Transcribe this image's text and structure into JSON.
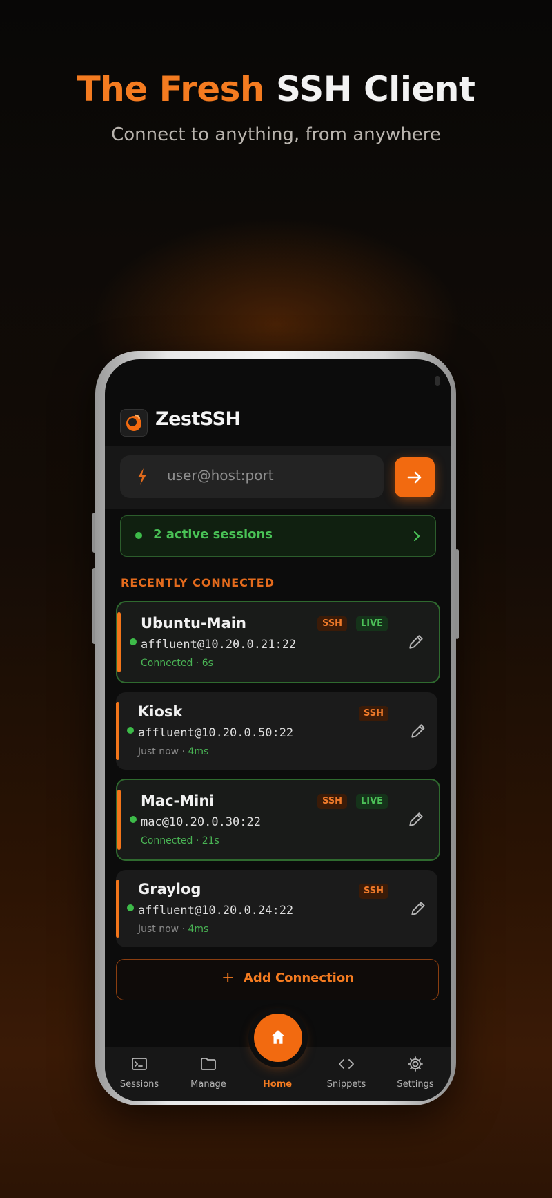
{
  "hero": {
    "title_accent": "The Fresh",
    "title_rest": "SSH Client",
    "subtitle": "Connect to anything, from anywhere"
  },
  "app": {
    "name": "ZestSSH",
    "logo_icon": "zest-logo-icon"
  },
  "quick_connect": {
    "placeholder": "user@host:port",
    "bolt_icon": "bolt-icon",
    "go_icon": "arrow-right-icon"
  },
  "active_sessions": {
    "label": "2 active sessions"
  },
  "recent": {
    "label": "RECENTLY CONNECTED",
    "items": [
      {
        "name": "Ubuntu-Main",
        "host": "affluent@10.20.0.21:22",
        "status": "Connected · 6s",
        "protocol": "SSH",
        "live": "LIVE",
        "is_live": true
      },
      {
        "name": "Kiosk",
        "host": "affluent@10.20.0.50:22",
        "status_prefix": "Just now · ",
        "latency": "4ms",
        "protocol": "SSH",
        "is_live": false
      },
      {
        "name": "Mac-Mini",
        "host": "mac@10.20.0.30:22",
        "status": "Connected · 21s",
        "protocol": "SSH",
        "live": "LIVE",
        "is_live": true
      },
      {
        "name": "Graylog",
        "host": "affluent@10.20.0.24:22",
        "status_prefix": "Just now · ",
        "latency": "4ms",
        "protocol": "SSH",
        "is_live": false
      }
    ]
  },
  "add_connection": {
    "label": "Add Connection"
  },
  "nav": {
    "items": [
      {
        "label": "Sessions",
        "icon": "terminal-icon"
      },
      {
        "label": "Manage",
        "icon": "folder-icon"
      },
      {
        "label": "Home",
        "icon": "home-icon",
        "active": true
      },
      {
        "label": "Snippets",
        "icon": "code-icon"
      },
      {
        "label": "Settings",
        "icon": "gear-icon"
      }
    ]
  },
  "colors": {
    "accent": "#f26a10",
    "live_green": "#49c256",
    "background": "#0c0c0c"
  }
}
